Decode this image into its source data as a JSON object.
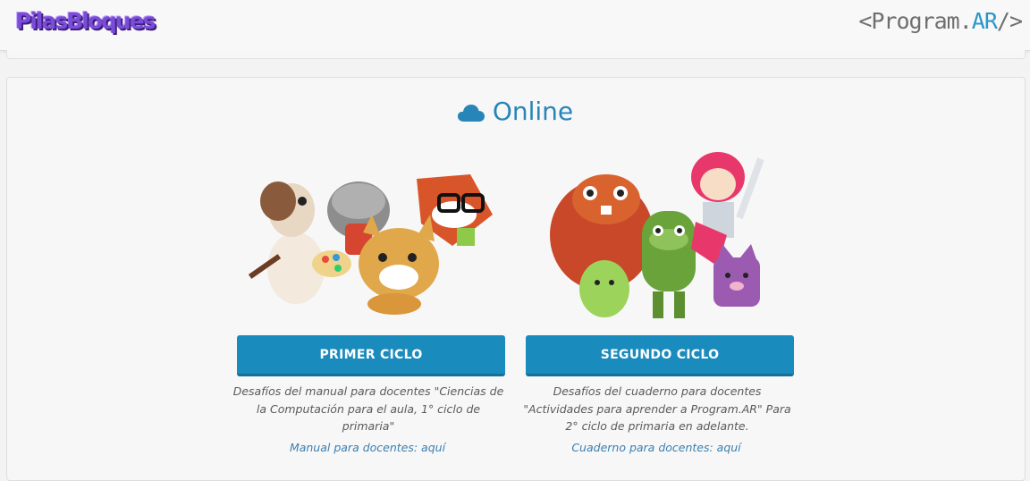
{
  "header": {
    "app_logo": "PilasBloques",
    "partner_logo_prefix": "<Program.",
    "partner_logo_accent": "AR",
    "partner_logo_suffix": "/>"
  },
  "section": {
    "title": "Online",
    "icon": "cloud-icon"
  },
  "cards": [
    {
      "button_label": "PRIMER CICLO",
      "description": "Desafíos del manual para docentes \"Ciencias de la Computación para el aula, 1° ciclo de primaria\"",
      "link_text": "Manual para docentes: aquí"
    },
    {
      "button_label": "SEGUNDO CICLO",
      "description": "Desafíos del cuaderno para docentes \"Actividades para aprender a Program.AR\" Para 2° ciclo de primaria en adelante.",
      "link_text": "Cuaderno para docentes: aquí"
    }
  ],
  "colors": {
    "accent": "#1a8bbd",
    "title": "#2785b8",
    "logo_purple": "#7b4bd9"
  }
}
